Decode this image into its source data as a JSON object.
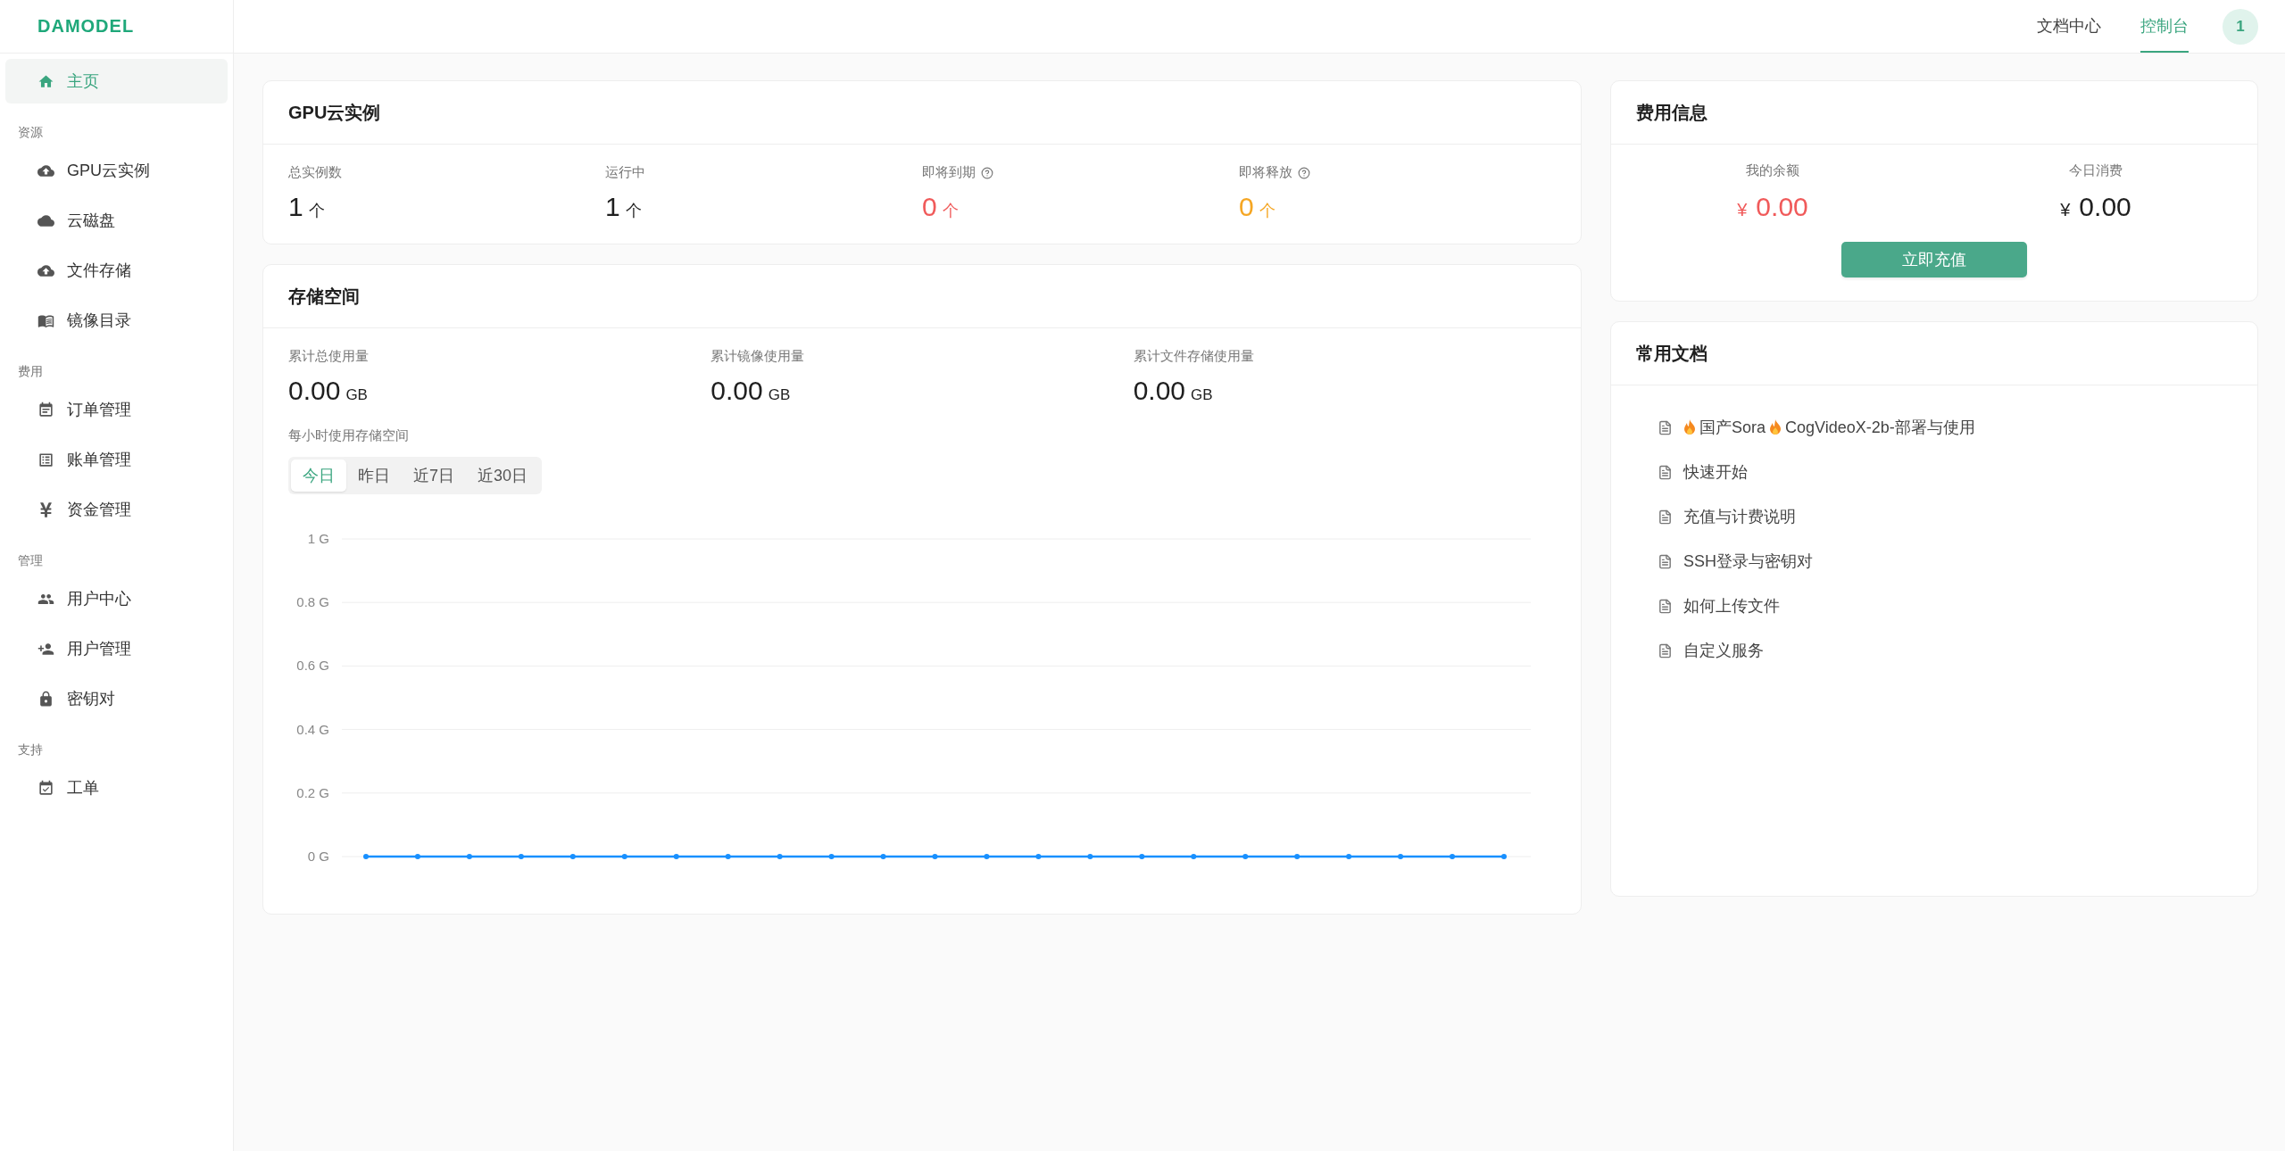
{
  "logo": "DAMODEL",
  "header": {
    "links": [
      {
        "label": "文档中心",
        "selected": false
      },
      {
        "label": "控制台",
        "selected": true
      }
    ],
    "avatar": "1"
  },
  "sidebar": {
    "items": [
      {
        "kind": "item",
        "label": "主页",
        "selected": true
      },
      {
        "kind": "section",
        "label": "资源"
      },
      {
        "kind": "item",
        "label": "GPU云实例",
        "selected": false
      },
      {
        "kind": "item",
        "label": "云磁盘",
        "selected": false
      },
      {
        "kind": "item",
        "label": "文件存储",
        "selected": false
      },
      {
        "kind": "item",
        "label": "镜像目录",
        "selected": false
      },
      {
        "kind": "section",
        "label": "费用"
      },
      {
        "kind": "item",
        "label": "订单管理",
        "selected": false
      },
      {
        "kind": "item",
        "label": "账单管理",
        "selected": false
      },
      {
        "kind": "item",
        "label": "资金管理",
        "selected": false
      },
      {
        "kind": "section",
        "label": "管理"
      },
      {
        "kind": "item",
        "label": "用户中心",
        "selected": false
      },
      {
        "kind": "item",
        "label": "用户管理",
        "selected": false
      },
      {
        "kind": "item",
        "label": "密钥对",
        "selected": false
      },
      {
        "kind": "section",
        "label": "支持"
      },
      {
        "kind": "item",
        "label": "工单",
        "selected": false
      }
    ]
  },
  "gpu": {
    "title": "GPU云实例",
    "stats": [
      {
        "label": "总实例数",
        "value": "1",
        "unit": "个",
        "help": false,
        "color": "#1f1f1f"
      },
      {
        "label": "运行中",
        "value": "1",
        "unit": "个",
        "help": false,
        "color": "#1f1f1f"
      },
      {
        "label": "即将到期",
        "value": "0",
        "unit": "个",
        "help": true,
        "color": "#f05a5a"
      },
      {
        "label": "即将释放",
        "value": "0",
        "unit": "个",
        "help": true,
        "color": "#f5a623"
      }
    ]
  },
  "storage": {
    "title": "存储空间",
    "stats": [
      {
        "label": "累计总使用量",
        "value": "0.00",
        "unit": "GB"
      },
      {
        "label": "累计镜像使用量",
        "value": "0.00",
        "unit": "GB"
      },
      {
        "label": "累计文件存储使用量",
        "value": "0.00",
        "unit": "GB"
      }
    ],
    "chart_label": "每小时使用存储空间",
    "ranges": [
      {
        "label": "今日",
        "selected": true
      },
      {
        "label": "昨日",
        "selected": false
      },
      {
        "label": "近7日",
        "selected": false
      },
      {
        "label": "近30日",
        "selected": false
      }
    ],
    "chart_data": {
      "type": "line",
      "ylim": [
        0,
        1
      ],
      "yticks": [
        {
          "value": 0,
          "label": "0 G"
        },
        {
          "value": 0.2,
          "label": "0.2 G"
        },
        {
          "value": 0.4,
          "label": "0.4 G"
        },
        {
          "value": 0.6,
          "label": "0.6 G"
        },
        {
          "value": 0.8,
          "label": "0.8 G"
        },
        {
          "value": 1,
          "label": "1 G"
        }
      ],
      "grid": true,
      "series": [
        {
          "color": "#1890ff",
          "marker": true,
          "values": [
            0,
            0,
            0,
            0,
            0,
            0,
            0,
            0,
            0,
            0,
            0,
            0,
            0,
            0,
            0,
            0,
            0,
            0,
            0,
            0,
            0,
            0,
            0
          ]
        }
      ]
    }
  },
  "fees": {
    "title": "费用信息",
    "stats": [
      {
        "label": "我的余额",
        "currency": "¥",
        "value": "0.00",
        "color": "#f05a5a"
      },
      {
        "label": "今日消费",
        "currency": "¥",
        "value": "0.00",
        "color": "#1f1f1f"
      }
    ],
    "button": "立即充值"
  },
  "docs": {
    "title": "常用文档",
    "items": [
      {
        "kind": "hot",
        "segments": [
          "国产Sora",
          "CogVideoX-2b-部署与使用"
        ]
      },
      {
        "kind": "plain",
        "title": "快速开始"
      },
      {
        "kind": "plain",
        "title": "充值与计费说明"
      },
      {
        "kind": "plain",
        "title": "SSH登录与密钥对"
      },
      {
        "kind": "plain",
        "title": "如何上传文件"
      },
      {
        "kind": "plain",
        "title": "自定义服务"
      }
    ]
  }
}
